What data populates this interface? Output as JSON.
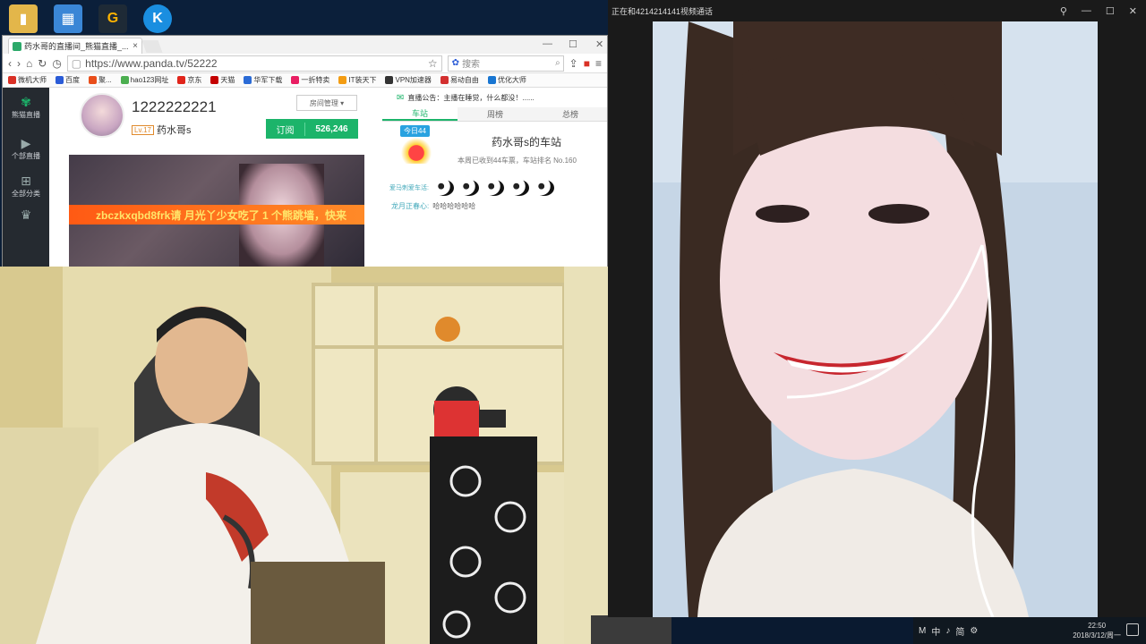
{
  "desktop": {
    "icons": [
      {
        "name": "folder-icon",
        "color": "#e3b64a",
        "glyph": "▮"
      },
      {
        "name": "control-panel-icon",
        "color": "#3a86d6",
        "glyph": "▦"
      },
      {
        "name": "game-icon",
        "color": "#1e2a36",
        "glyph": "G"
      },
      {
        "name": "k-app-icon",
        "color": "#1a8ee0",
        "glyph": "K"
      }
    ]
  },
  "browser": {
    "tab_title": "药水哥的直播间_熊猫直播_...",
    "url": "https://www.panda.tv/52222",
    "search_placeholder": "搜索",
    "bookmarks": [
      {
        "label": "微机大师",
        "color": "#d93025"
      },
      {
        "label": "百度",
        "color": "#2a5bd7"
      },
      {
        "label": "聚...",
        "color": "#e94e1b"
      },
      {
        "label": "hao123网址",
        "color": "#4caf50"
      },
      {
        "label": "京东",
        "color": "#e1251b"
      },
      {
        "label": "天猫",
        "color": "#c40000"
      },
      {
        "label": "华军下载",
        "color": "#2b6bd6"
      },
      {
        "label": "一折特卖",
        "color": "#e91e63"
      },
      {
        "label": "IT装天下",
        "color": "#f39c12"
      },
      {
        "label": "VPN加速器",
        "color": "#333333"
      },
      {
        "label": "易动自由",
        "color": "#d32f2f"
      },
      {
        "label": "优化大师",
        "color": "#1976d2"
      }
    ]
  },
  "panda": {
    "side_items": [
      {
        "label": "熊猫直播",
        "icon": "panda-logo-icon"
      },
      {
        "label": "个部直播",
        "icon": "video-camera-icon"
      },
      {
        "label": "全部分类",
        "icon": "grid-icon"
      },
      {
        "label": "",
        "icon": "trophy-icon"
      }
    ],
    "room_number": "1222222221",
    "level": "Lv.17",
    "nickname": "药水哥s",
    "share_label": "房间管理",
    "subscribe_label": "订阅",
    "subscribers": "526,246",
    "banner_text": "zbczkxqbd8frk请 月光丫少女吃了 1 个熊跳墙，快来",
    "notice": "直播公告：主播在睡觉，什么都没！......",
    "tabs": [
      "车站",
      "周榜",
      "总榜"
    ],
    "today_badge": "今日44",
    "station_title": "药水哥s的车站",
    "station_sub": "本周已收到44车票，车站排名 No.160",
    "fans_label": "爱马刺爱车活:",
    "chat_user": "龙月正春心:",
    "chat_text": "哈哈哈哈哈哈"
  },
  "video_call": {
    "title": "正在和4214214141视频通话"
  },
  "taskbar": {
    "tray_icons": [
      "M",
      "中",
      "♪",
      "简",
      "⚙"
    ],
    "time": "22:50",
    "date": "2018/3/12/周一"
  }
}
